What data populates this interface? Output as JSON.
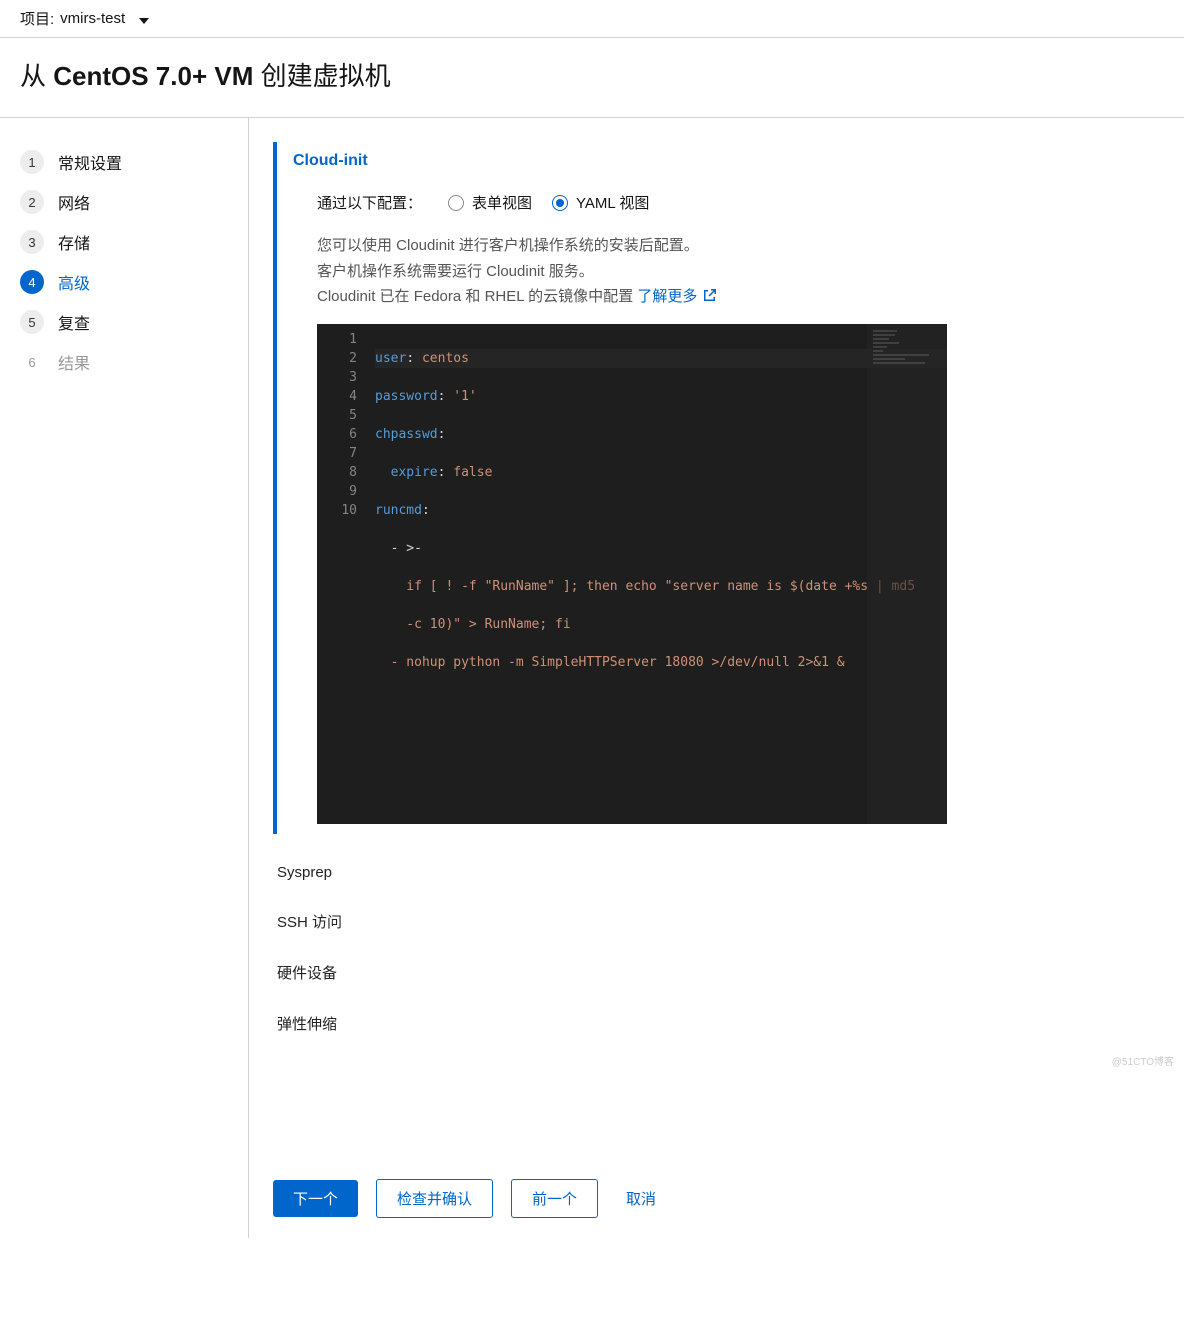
{
  "topbar": {
    "label": "项目:",
    "project": "vmirs-test"
  },
  "page_title": {
    "prefix": "从 ",
    "bold": "CentOS 7.0+ VM",
    "suffix": " 创建虚拟机"
  },
  "steps": [
    {
      "num": "1",
      "label": "常规设置"
    },
    {
      "num": "2",
      "label": "网络"
    },
    {
      "num": "3",
      "label": "存储"
    },
    {
      "num": "4",
      "label": "高级"
    },
    {
      "num": "5",
      "label": "复查"
    },
    {
      "num": "6",
      "label": "结果"
    }
  ],
  "cloudinit": {
    "title": "Cloud-init",
    "config_label": "通过以下配置：",
    "radio_form": "表单视图",
    "radio_yaml": "YAML 视图",
    "desc_line1": "您可以使用 Cloudinit 进行客户机操作系统的安装后配置。",
    "desc_line2": "客户机操作系统需要运行 Cloudinit 服务。",
    "desc_line3_pre": "Cloudinit 已在 Fedora 和 RHEL 的云镜像中配置 ",
    "learn_more": "了解更多"
  },
  "code": {
    "l1_k": "user",
    "l1_v": "centos",
    "l2_k": "password",
    "l2_v": "'1'",
    "l3_k": "chpasswd",
    "l4_k": "expire",
    "l4_v": "false",
    "l5_k": "runcmd",
    "l6": "  - >-",
    "l7": "    if [ ! -f \"RunName\" ]; then echo \"server name is $(date +%s | md5",
    "l8": "    -c 10)\" > RunName; fi",
    "l9": "  - nohup python -m SimpleHTTPServer 18080 >/dev/null 2>&1 &"
  },
  "line_numbers": [
    "1",
    "2",
    "3",
    "4",
    "5",
    "6",
    "7",
    "8",
    "9",
    "10"
  ],
  "sections": {
    "sysprep": "Sysprep",
    "ssh": "SSH 访问",
    "hardware": "硬件设备",
    "scaling": "弹性伸缩"
  },
  "footer": {
    "next": "下一个",
    "review": "检查并确认",
    "prev": "前一个",
    "cancel": "取消"
  },
  "watermark": "@51CTO博客"
}
